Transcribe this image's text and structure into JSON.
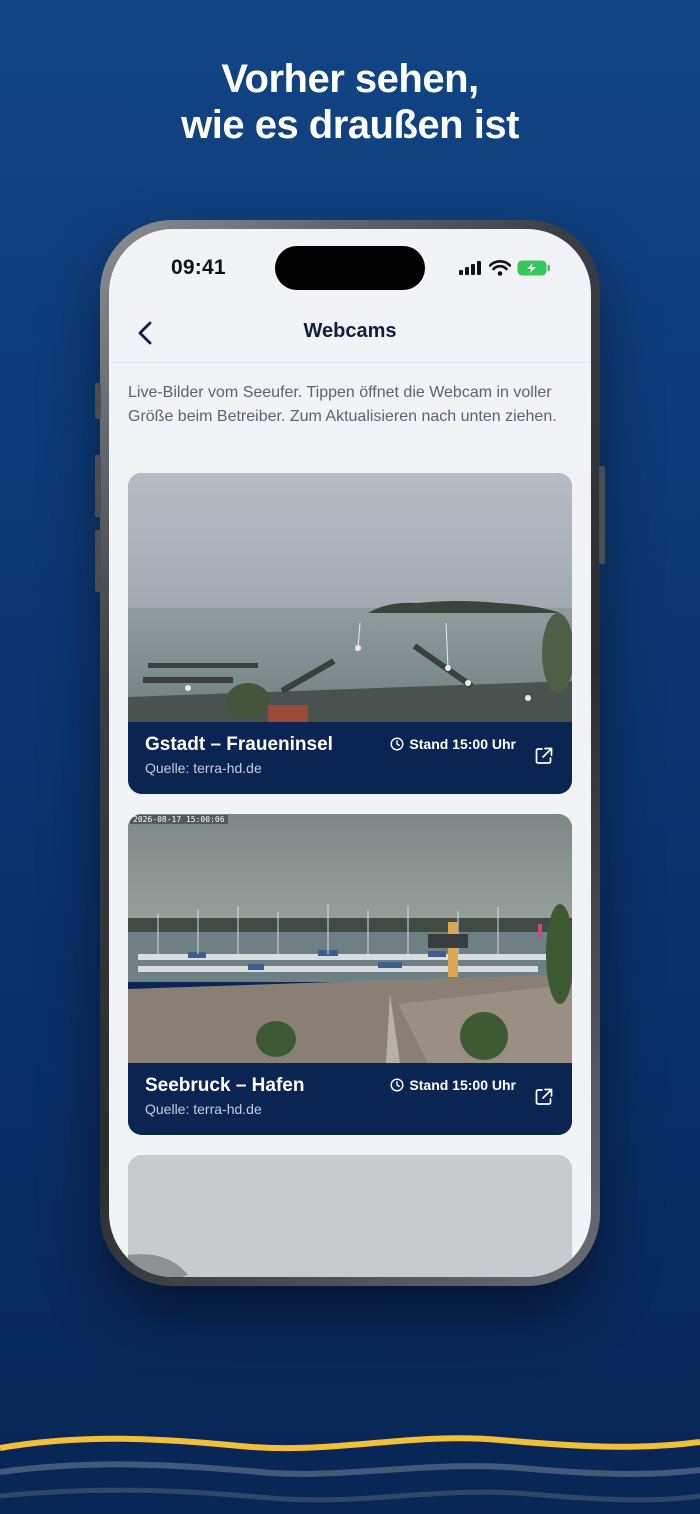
{
  "headline": {
    "line1": "Vorher sehen,",
    "line2": "wie es draußen ist"
  },
  "status_bar": {
    "time": "09:41",
    "icons": [
      "cellular-signal-icon",
      "wifi-icon",
      "battery-charging-icon"
    ]
  },
  "nav": {
    "back_icon": "chevron-left-icon",
    "title": "Webcams"
  },
  "intro_text": "Live-Bilder vom Seeufer. Tippen öffnet die Webcam in voller Größe beim Betreiber. Zum Aktualisieren nach unten ziehen.",
  "webcams": [
    {
      "name": "Gstadt – Fraueninsel",
      "source": "Quelle: terra-hd.de",
      "stand": "Stand 15:00 Uhr"
    },
    {
      "name": "Seebruck – Hafen",
      "source": "Quelle: terra-hd.de",
      "stand": "Stand 15:00 Uhr",
      "image_timestamp": "2026-08-17 15:00:06"
    }
  ],
  "colors": {
    "background": "#0d3a78",
    "card_footer": "#0b2553",
    "accent_wave": "#f2c037",
    "battery": "#34c759"
  }
}
